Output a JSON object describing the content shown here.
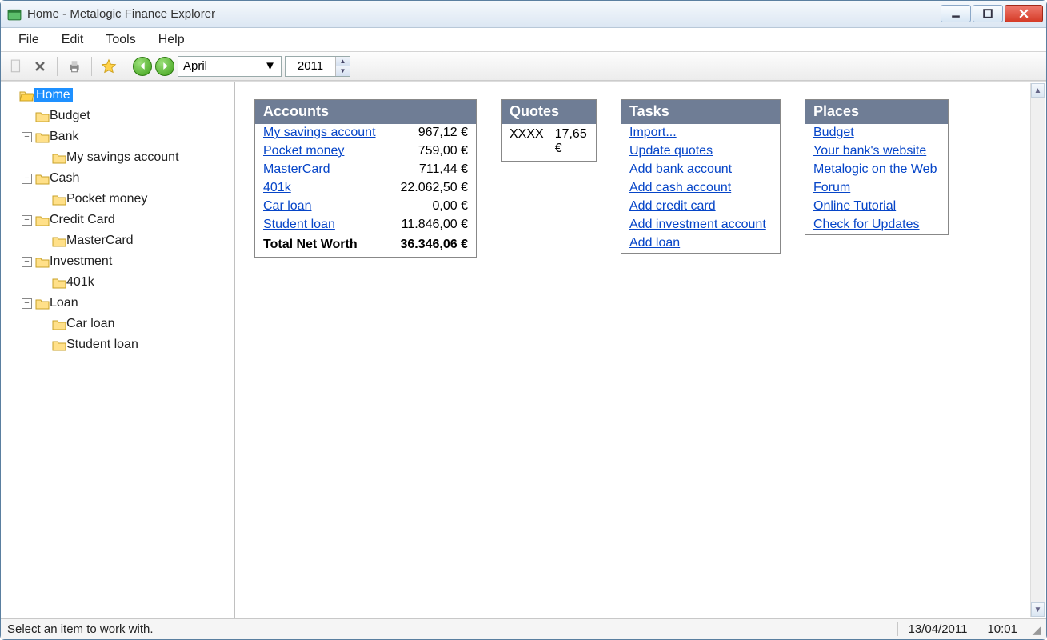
{
  "window": {
    "title": "Home - Metalogic Finance Explorer"
  },
  "menubar": {
    "items": [
      "File",
      "Edit",
      "Tools",
      "Help"
    ]
  },
  "toolbar": {
    "month": "April",
    "year": "2011"
  },
  "tree": {
    "root": {
      "label": "Home",
      "selected": true
    },
    "nodes": [
      {
        "label": "Budget",
        "level": 1,
        "exp": "none"
      },
      {
        "label": "Bank",
        "level": 1,
        "exp": "minus",
        "children": [
          "My savings account"
        ]
      },
      {
        "label": "Cash",
        "level": 1,
        "exp": "minus",
        "children": [
          "Pocket money"
        ]
      },
      {
        "label": "Credit Card",
        "level": 1,
        "exp": "minus",
        "children": [
          "MasterCard"
        ]
      },
      {
        "label": "Investment",
        "level": 1,
        "exp": "minus",
        "children": [
          "401k"
        ]
      },
      {
        "label": "Loan",
        "level": 1,
        "exp": "minus",
        "children": [
          "Car loan",
          "Student loan"
        ]
      }
    ]
  },
  "panels": {
    "accounts": {
      "title": "Accounts",
      "rows": [
        {
          "name": "My savings account",
          "value": "967,12 €"
        },
        {
          "name": "Pocket money",
          "value": "759,00 €"
        },
        {
          "name": "MasterCard",
          "value": "711,44 €"
        },
        {
          "name": "401k",
          "value": "22.062,50 €"
        },
        {
          "name": "Car loan",
          "value": "0,00 €"
        },
        {
          "name": "Student loan",
          "value": "11.846,00 €"
        }
      ],
      "total_label": "Total Net Worth",
      "total_value": "36.346,06 €"
    },
    "quotes": {
      "title": "Quotes",
      "rows": [
        {
          "symbol": "XXXX",
          "value": "17,65 €"
        }
      ]
    },
    "tasks": {
      "title": "Tasks",
      "items": [
        "Import...",
        "Update quotes",
        "Add bank account",
        "Add cash account",
        "Add credit card",
        "Add investment account",
        "Add loan"
      ]
    },
    "places": {
      "title": "Places",
      "items": [
        "Budget",
        "Your bank's website",
        "Metalogic on the Web",
        "Forum",
        "Online Tutorial",
        "Check for Updates"
      ]
    }
  },
  "statusbar": {
    "message": "Select an item to work with.",
    "date": "13/04/2011",
    "time": "10:01"
  }
}
